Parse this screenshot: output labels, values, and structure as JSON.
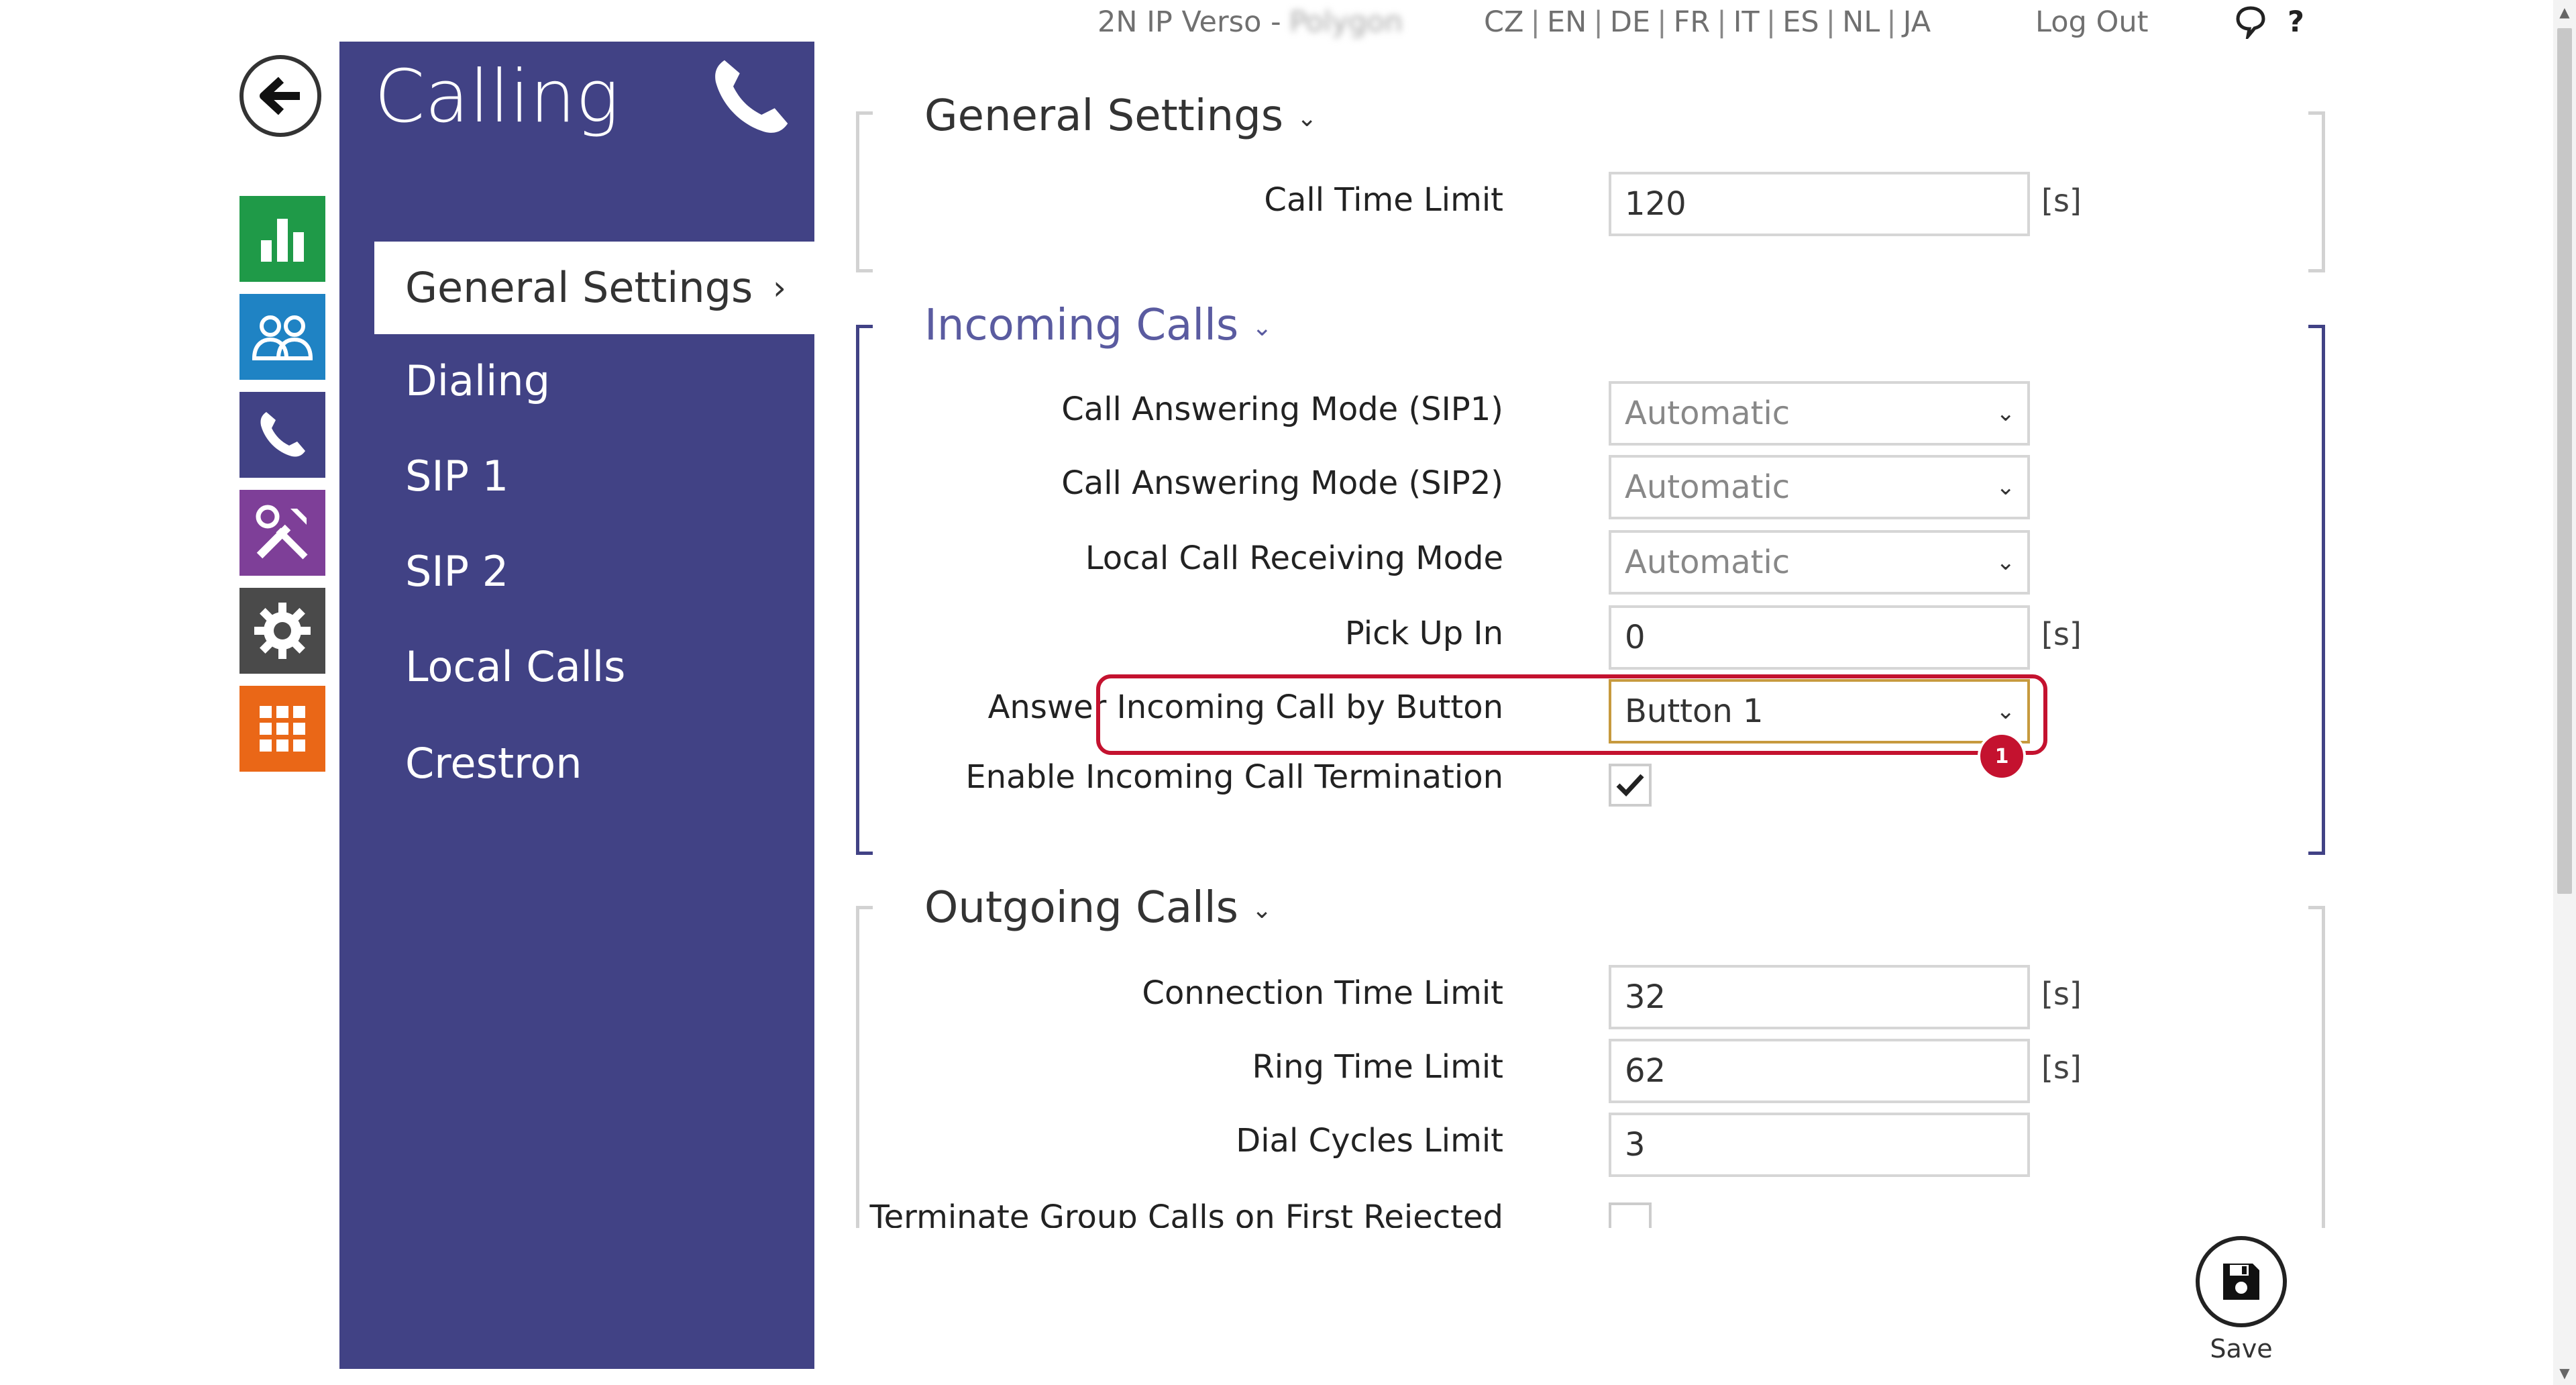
{
  "topbar": {
    "device_model": "2N IP Verso -",
    "device_name": "Polygon",
    "languages": [
      "CZ",
      "EN",
      "DE",
      "FR",
      "IT",
      "ES",
      "NL",
      "JA"
    ],
    "logout": "Log Out",
    "chat_icon": "speech-bubble-icon",
    "help": "?"
  },
  "iconbar": {
    "back_icon": "arrow-left-icon",
    "modules": [
      {
        "name": "status",
        "icon": "bar-chart-icon",
        "color": "#1f9a48"
      },
      {
        "name": "directory",
        "icon": "users-icon",
        "color": "#1f83c4"
      },
      {
        "name": "calling",
        "icon": "phone-icon",
        "color": "#414285"
      },
      {
        "name": "hardware",
        "icon": "tools-icon",
        "color": "#7e3f98"
      },
      {
        "name": "services",
        "icon": "gear-icon",
        "color": "#4a4a4a"
      },
      {
        "name": "system",
        "icon": "grid-icon",
        "color": "#ea6717"
      }
    ]
  },
  "sidebar": {
    "title": "Calling",
    "items": [
      {
        "label": "General Settings",
        "active": true
      },
      {
        "label": "Dialing"
      },
      {
        "label": "SIP 1"
      },
      {
        "label": "SIP 2"
      },
      {
        "label": "Local Calls"
      },
      {
        "label": "Crestron"
      }
    ]
  },
  "general": {
    "title": "General Settings",
    "call_time_limit": {
      "label": "Call Time Limit",
      "value": "120",
      "unit": "[s]"
    }
  },
  "incoming": {
    "title": "Incoming Calls",
    "sip1_mode": {
      "label": "Call Answering Mode (SIP1)",
      "value": "Automatic"
    },
    "sip2_mode": {
      "label": "Call Answering Mode (SIP2)",
      "value": "Automatic"
    },
    "local_mode": {
      "label": "Local Call Receiving Mode",
      "value": "Automatic"
    },
    "pick_up_in": {
      "label": "Pick Up In",
      "value": "0",
      "unit": "[s]"
    },
    "answer_by_button": {
      "label": "Answer Incoming Call by Button",
      "value": "Button 1"
    },
    "termination": {
      "label": "Enable Incoming Call Termination",
      "checked": true
    }
  },
  "outgoing": {
    "title": "Outgoing Calls",
    "connection_limit": {
      "label": "Connection Time Limit",
      "value": "32",
      "unit": "[s]"
    },
    "ring_limit": {
      "label": "Ring Time Limit",
      "value": "62",
      "unit": "[s]"
    },
    "dial_cycles": {
      "label": "Dial Cycles Limit",
      "value": "3"
    },
    "terminate_group": {
      "label": "Terminate Group Calls on First Rejected",
      "checked": false
    }
  },
  "annotation": {
    "badge": "1",
    "color": "#c4122f"
  },
  "save": {
    "label": "Save"
  }
}
